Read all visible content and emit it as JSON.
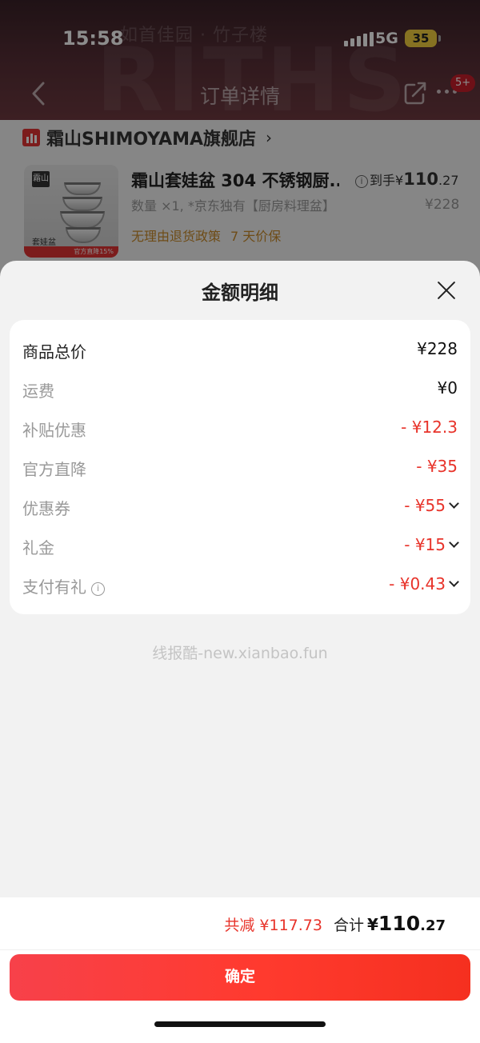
{
  "status_bar": {
    "time": "15:58",
    "network": "5G",
    "battery": "35"
  },
  "background_page": {
    "watermark_text": "如首佳园 · 竹子楼",
    "nav_title": "订单详情",
    "more_badge": "5+",
    "store": {
      "name": "霜山SHIMOYAMA旗舰店",
      "chevron": "›"
    },
    "product": {
      "title": "霜山套娃盆 304 不锈钢厨...",
      "quantity_spec": "数量 ×1, *京东独有【厨房料理盆】",
      "policy_return": "无理由退货政策",
      "policy_price": "7 天价保",
      "final_price_label": "到手",
      "final_price_yen": "¥",
      "final_price_int": "110",
      "final_price_dec": ".27",
      "original_price": "¥228",
      "thumb_brand": "霜山",
      "thumb_label": "套娃盆",
      "thumb_tag": "官方直降15%"
    }
  },
  "sheet": {
    "title": "金额明细",
    "rows": [
      {
        "label": "商品总价",
        "value": "¥228"
      },
      {
        "label": "运费",
        "value": "¥0"
      },
      {
        "label": "补贴优惠",
        "value": "- ¥12.3"
      },
      {
        "label": "官方直降",
        "value": "- ¥35"
      },
      {
        "label": "优惠券",
        "value": "- ¥55"
      },
      {
        "label": "礼金",
        "value": "- ¥15"
      },
      {
        "label": "支付有礼",
        "value": "- ¥0.43"
      }
    ],
    "watermark": "线报酷-new.xianbao.fun",
    "summary": {
      "saved": "共减 ¥117.73",
      "total_label": "合计",
      "total_yen": "¥",
      "total_int": "110",
      "total_dec": ".27"
    },
    "confirm_label": "确定"
  },
  "colors": {
    "accent_red": "#e8332a",
    "button_red": "#f7414a",
    "policy_orange": "#c98a2a"
  }
}
